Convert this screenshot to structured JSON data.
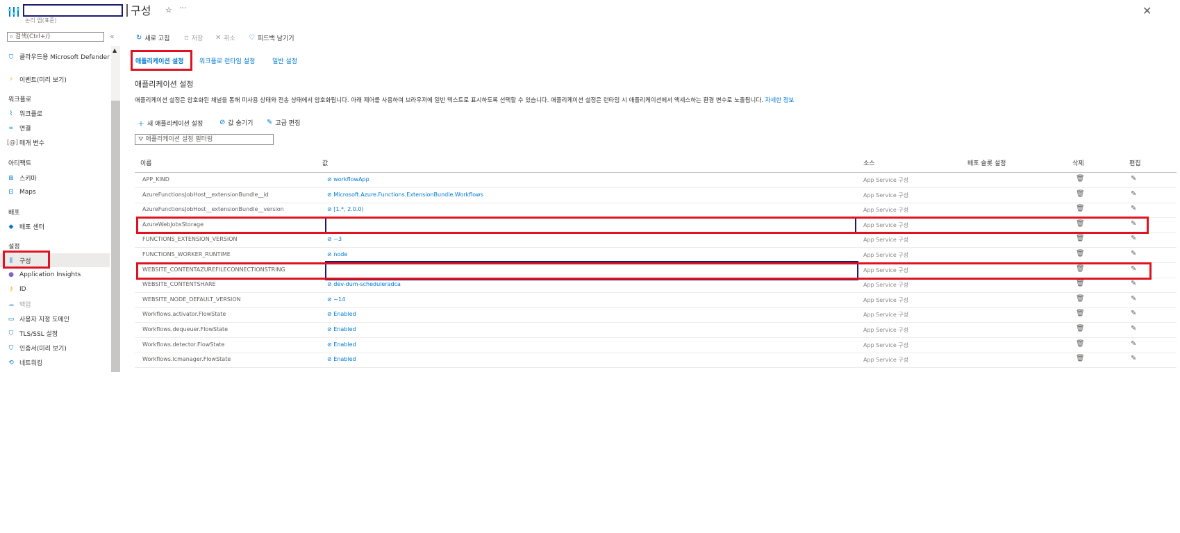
{
  "header": {
    "title": "구성",
    "subtitle": "논리 앱(표준)"
  },
  "sidebar": {
    "search_placeholder": "검색(Ctrl+/)",
    "items_top": [
      {
        "label": "클라우드용 Microsoft Defender",
        "icon": "shield-icon"
      },
      {
        "label": "이벤트(미리 보기)",
        "icon": "lightning-icon"
      }
    ],
    "sections": [
      {
        "title": "워크플로",
        "items": [
          {
            "label": "워크플로",
            "icon": "workflow-icon"
          },
          {
            "label": "연결",
            "icon": "link-icon"
          },
          {
            "label": "매개 변수",
            "icon": "parameters-icon"
          }
        ]
      },
      {
        "title": "아티팩트",
        "items": [
          {
            "label": "스키마",
            "icon": "schema-icon"
          },
          {
            "label": "Maps",
            "icon": "maps-icon"
          }
        ]
      },
      {
        "title": "배포",
        "items": [
          {
            "label": "배포 센터",
            "icon": "cube-icon"
          }
        ]
      },
      {
        "title": "설정",
        "items": [
          {
            "label": "구성",
            "icon": "config-icon"
          },
          {
            "label": "Application Insights",
            "icon": "insights-icon"
          },
          {
            "label": "ID",
            "icon": "key-icon"
          },
          {
            "label": "백업",
            "icon": "cloud-icon"
          },
          {
            "label": "사용자 지정 도메인",
            "icon": "domain-icon"
          },
          {
            "label": "TLS/SSL 설정",
            "icon": "shield-icon"
          },
          {
            "label": "인증서(미리 보기)",
            "icon": "certificate-icon"
          },
          {
            "label": "네트워킹",
            "icon": "network-icon"
          }
        ]
      }
    ]
  },
  "toolbar": {
    "refresh": "새로 고침",
    "save": "저장",
    "discard": "취소",
    "feedback": "피드백 남기기"
  },
  "tabs": [
    "애플리케이션 설정",
    "워크플로 런타임 설정",
    "일반 설정"
  ],
  "section": {
    "title": "애플리케이션 설정",
    "description": "애플리케이션 설정은 암호화된 채널을 통해 미사용 상태와 전송 상태에서 암호화됩니다. 아래 제어를 사용하여 브라우저에 일반 텍스트로 표시하도록 선택할 수 있습니다. 애플리케이션 설정은 런타임 시 애플리케이션에서 액세스하는 환경 변수로 노출됩니다.",
    "learn_more": "자세한 정보"
  },
  "actions": {
    "new_setting": "새 애플리케이션 설정",
    "show_values": "값 숨기기",
    "advanced_edit": "고급 편집"
  },
  "filter_placeholder": "애플리케이션 설정 필터링",
  "table": {
    "headers": [
      "이름",
      "값",
      "소스",
      "배포 슬롯 설정",
      "삭제",
      "편집"
    ],
    "rows": [
      {
        "name": "APP_KIND",
        "value": "workflowApp",
        "source": "App Service 구성"
      },
      {
        "name": "AzureFunctionsJobHost__extensionBundle__id",
        "value": "Microsoft.Azure.Functions.ExtensionBundle.Workflows",
        "source": "App Service 구성"
      },
      {
        "name": "AzureFunctionsJobHost__extensionBundle__version",
        "value": "[1.*, 2.0.0)",
        "source": "App Service 구성"
      },
      {
        "name": "AzureWebJobsStorage",
        "value": "",
        "source": "App Service 구성"
      },
      {
        "name": "FUNCTIONS_EXTENSION_VERSION",
        "value": "~3",
        "source": "App Service 구성"
      },
      {
        "name": "FUNCTIONS_WORKER_RUNTIME",
        "value": "node",
        "source": "App Service 구성"
      },
      {
        "name": "WEBSITE_CONTENTAZUREFILECONNECTIONSTRING",
        "value": "",
        "source": "App Service 구성"
      },
      {
        "name": "WEBSITE_CONTENTSHARE",
        "value": "dev-dum-scheduleradca",
        "source": "App Service 구성"
      },
      {
        "name": "WEBSITE_NODE_DEFAULT_VERSION",
        "value": "~14",
        "source": "App Service 구성"
      },
      {
        "name": "Workflows.activator.FlowState",
        "value": "Enabled",
        "source": "App Service 구성"
      },
      {
        "name": "Workflows.dequeuer.FlowState",
        "value": "Enabled",
        "source": "App Service 구성"
      },
      {
        "name": "Workflows.detector.FlowState",
        "value": "Enabled",
        "source": "App Service 구성"
      },
      {
        "name": "Workflows.lcmanager.FlowState",
        "value": "Enabled",
        "source": "App Service 구성"
      }
    ]
  }
}
